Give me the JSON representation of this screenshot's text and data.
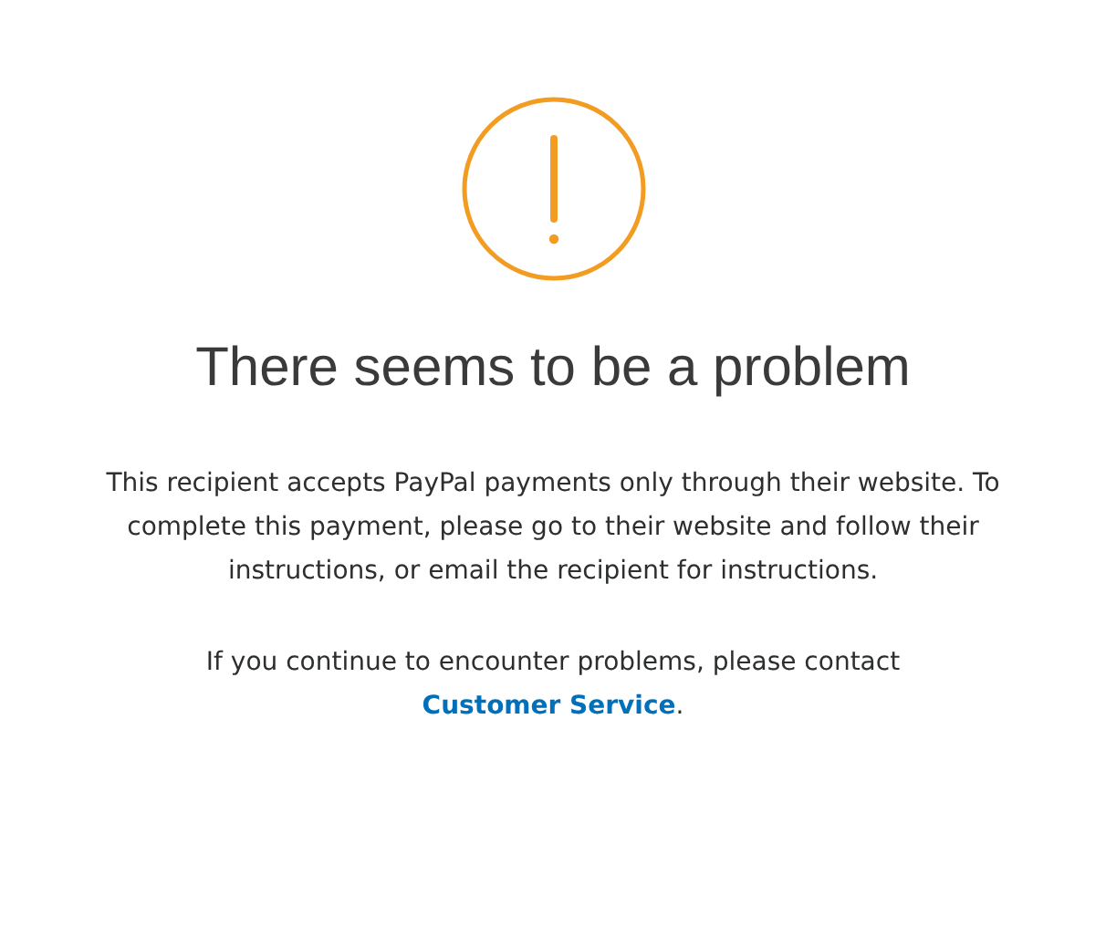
{
  "title": "There seems to be a problem",
  "message": "This recipient accepts PayPal payments only through their website. To complete this payment, please go to their website and follow their instructions, or email the recipient for instructions.",
  "contact": {
    "text_before": "If you continue to encounter problems, please contact",
    "link": "Customer Service",
    "text_after": "."
  }
}
